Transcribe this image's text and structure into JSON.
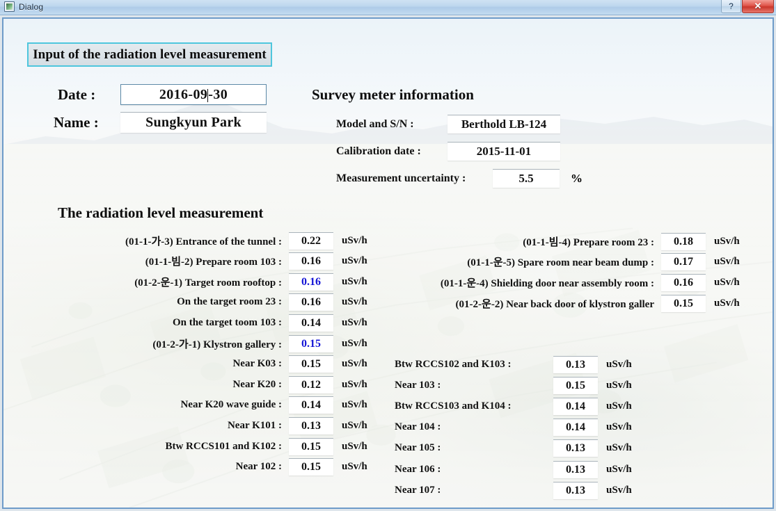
{
  "window": {
    "title": "Dialog",
    "icon": "app-icon",
    "help_button": "?",
    "close_button": "✕"
  },
  "header": {
    "title": "Input of the radiation level measurement"
  },
  "identity": {
    "date_label": "Date :",
    "date_value_before_caret": "2016-09",
    "date_value_after_caret": "-30",
    "date_value": "2016-09-30",
    "name_label": "Name :",
    "name_value": "Sungkyun Park"
  },
  "survey_meter": {
    "title": "Survey meter information",
    "rows": [
      {
        "label": "Model and S/N :",
        "value": "Berthold LB-124"
      },
      {
        "label": "Calibration date :",
        "value": "2015-11-01"
      },
      {
        "label": "Measurement uncertainty :",
        "value": "5.5",
        "unit": "%"
      }
    ]
  },
  "measurement": {
    "title": "The radiation level measurement",
    "unit": "uSv/h",
    "left_column": [
      {
        "label": "(01-1-가-3) Entrance of the tunnel :",
        "value": "0.22",
        "color": "black"
      },
      {
        "label": "(01-1-빔-2) Prepare room 103 :",
        "value": "0.16",
        "color": "black"
      },
      {
        "label": "(01-2-운-1) Target room rooftop :",
        "value": "0.16",
        "color": "blue"
      },
      {
        "label": "On the target room 23 :",
        "value": "0.16",
        "color": "black"
      },
      {
        "label": "On the target toom 103 :",
        "value": "0.14",
        "color": "black"
      },
      {
        "label": "(01-2-가-1) Klystron gallery :",
        "value": "0.15",
        "color": "blue"
      },
      {
        "label": "Near K03 :",
        "value": "0.15",
        "color": "black"
      },
      {
        "label": "Near K20 :",
        "value": "0.12",
        "color": "black"
      },
      {
        "label": "Near K20 wave guide :",
        "value": "0.14",
        "color": "black"
      },
      {
        "label": "Near K101 :",
        "value": "0.13",
        "color": "black"
      },
      {
        "label": "Btw RCCS101 and K102 :",
        "value": "0.15",
        "color": "black"
      },
      {
        "label": "Near 102 :",
        "value": "0.15",
        "color": "black"
      }
    ],
    "right_column_top": [
      {
        "label": "(01-1-빔-4) Prepare room 23 :",
        "value": "0.18",
        "color": "black"
      },
      {
        "label": "(01-1-운-5) Spare room near beam dump :",
        "value": "0.17",
        "color": "black"
      },
      {
        "label": "(01-1-운-4) Shielding door near assembly room :",
        "value": "0.16",
        "color": "black"
      },
      {
        "label": "(01-2-운-2) Near back door of klystron galler",
        "value": "0.15",
        "color": "black"
      }
    ],
    "right_column_lower": [
      {
        "label": "Btw RCCS102 and K103 :",
        "value": "0.13",
        "color": "black"
      },
      {
        "label": "Near 103 :",
        "value": "0.15",
        "color": "black"
      },
      {
        "label": "Btw RCCS103 and K104 :",
        "value": "0.14",
        "color": "black"
      },
      {
        "label": "Near 104 :",
        "value": "0.14",
        "color": "black"
      },
      {
        "label": "Near 105 :",
        "value": "0.13",
        "color": "black"
      },
      {
        "label": "Near 106 :",
        "value": "0.13",
        "color": "black"
      },
      {
        "label": "Near 107 :",
        "value": "0.13",
        "color": "black"
      }
    ]
  },
  "colors": {
    "header_border": "#4ec6dd",
    "frame_border": "#6e9bc9",
    "highlight_value": "#1414d6",
    "titlebar": "#bdd7ee",
    "close_button": "#c9362b"
  }
}
